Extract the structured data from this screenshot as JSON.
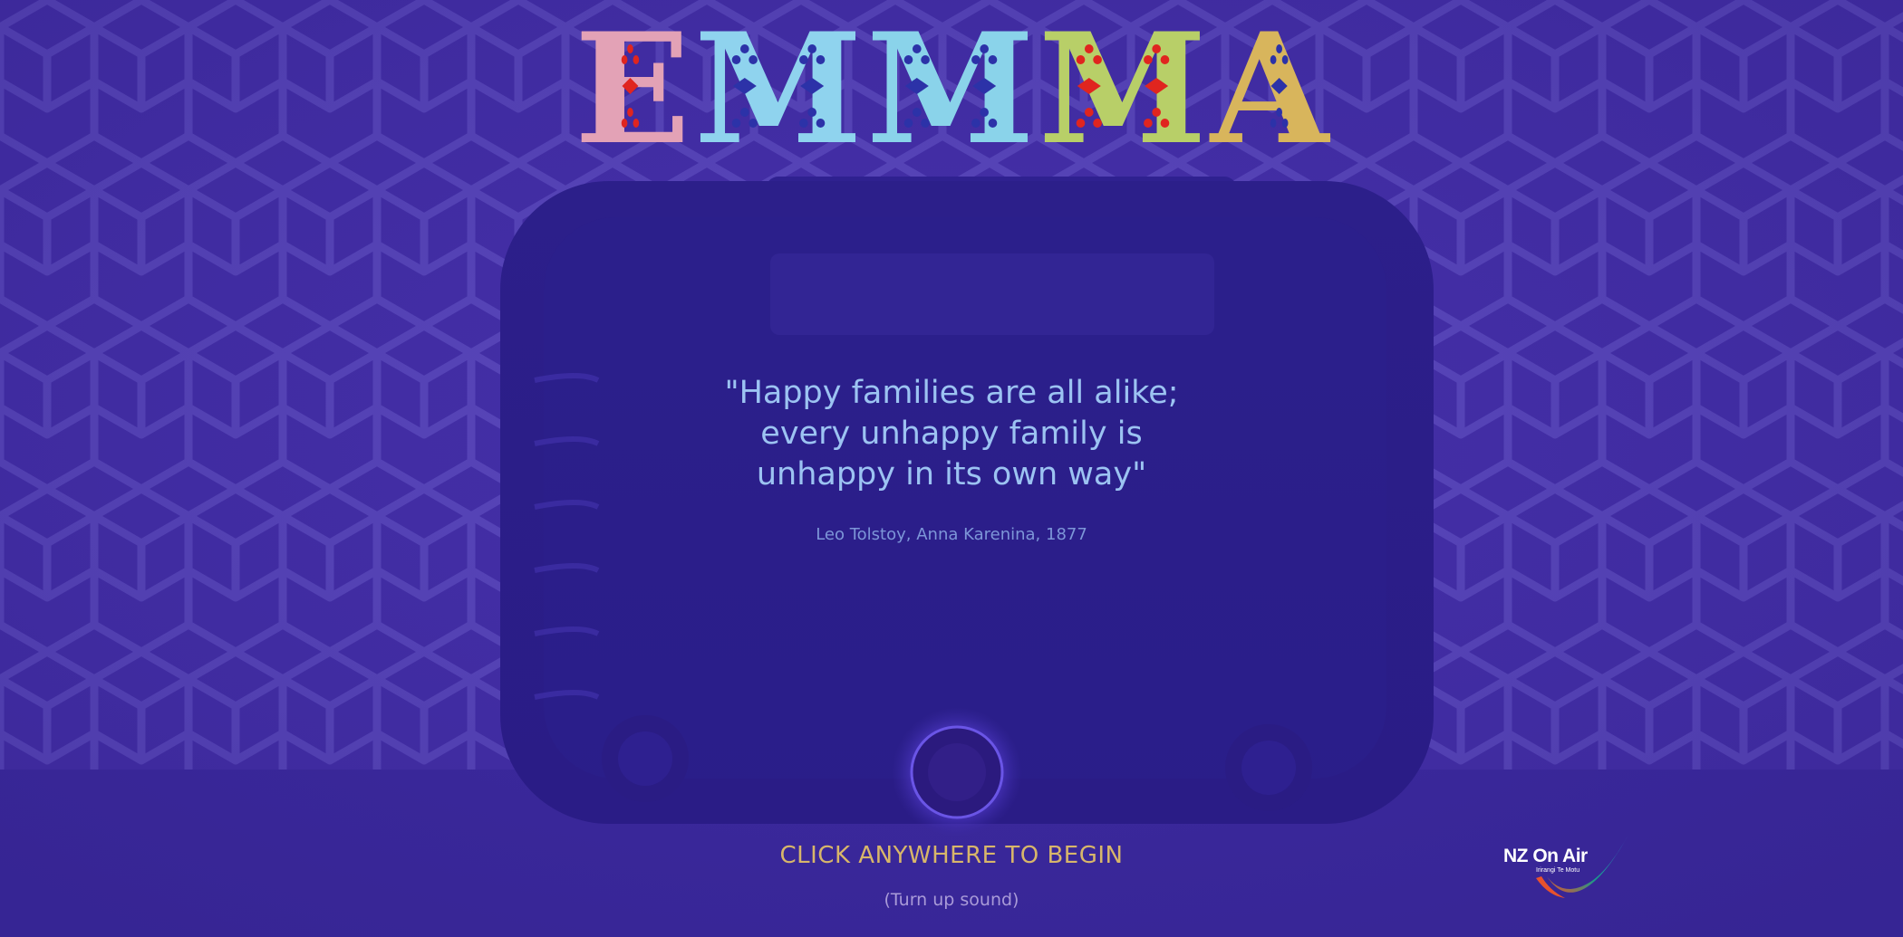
{
  "title": {
    "letters": [
      {
        "char": "E",
        "color": "#e3a2b6",
        "ornament_color": "#e0251f"
      },
      {
        "char": "M",
        "color": "#8fd3ee",
        "ornament_color": "#2c32a8"
      },
      {
        "char": "M",
        "color": "#8ad3ea",
        "ornament_color": "#2c32a8"
      },
      {
        "char": "M",
        "color": "#b8cf68",
        "ornament_color": "#e0251f"
      },
      {
        "char": "A",
        "color": "#d8b55c",
        "ornament_color": "#2c32a8"
      }
    ]
  },
  "quote": {
    "lines": [
      "\"Happy families are all alike;",
      "every unhappy family is",
      "unhappy in its own way\""
    ],
    "attribution": "Leo Tolstoy, Anna Karenina, 1877"
  },
  "cta": {
    "begin_label": "CLICK ANYWHERE TO BEGIN",
    "sound_hint": "(Turn up sound)"
  },
  "logo": {
    "name": "NZ On Air",
    "subtitle": "Irirangi Te Motu"
  },
  "colors": {
    "background": "#4630a8",
    "quote": "#9cc3f2",
    "attribution": "#7d96d8",
    "cta": "#d8b66a"
  },
  "background": {
    "pattern": "hexagonal-cube-wallpaper",
    "object": "vintage-radio"
  }
}
